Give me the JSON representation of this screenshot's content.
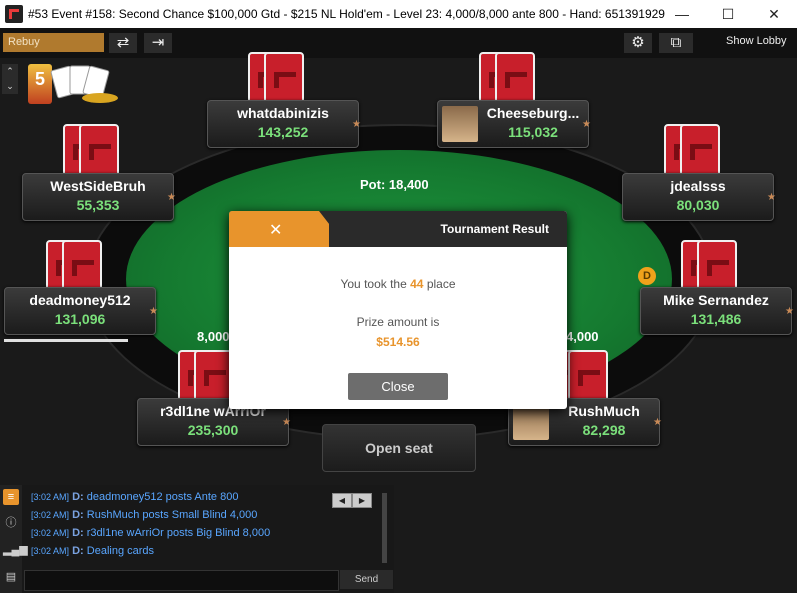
{
  "window": {
    "title": "#53 Event #158: Second Chance $100,000 Gtd - $215 NL Hold'em - Level 23: 4,000/8,000 ante 800 - Hand: 651391929",
    "minimize_glyph": "—",
    "maximize_glyph": "☐",
    "close_glyph": "✕"
  },
  "toolbar": {
    "rebuy_label": "Rebuy",
    "refresh_glyph": "⇄",
    "exit_glyph": "⇥",
    "settings_glyph": "⚙",
    "layout_glyph": "⧉",
    "show_lobby_label": "Show Lobby"
  },
  "logo": {
    "label": "5"
  },
  "table": {
    "pot_label": "Pot: 18,400",
    "dealer_label": "D",
    "open_seat_label": "Open seat"
  },
  "players": [
    {
      "name": "whatdabinizis",
      "stack": "143,252"
    },
    {
      "name": "Cheeseburg...",
      "stack": "115,032"
    },
    {
      "name": "WestSideBruh",
      "stack": "55,353"
    },
    {
      "name": "jdealsss",
      "stack": "80,030"
    },
    {
      "name": "deadmoney512",
      "stack": "131,096"
    },
    {
      "name": "Mike Sernandez",
      "stack": "131,486"
    },
    {
      "name": "r3dl1ne wArriOr",
      "stack": "235,300"
    },
    {
      "name": "RushMuch",
      "stack": "82,298"
    }
  ],
  "bets": {
    "left": "8,000",
    "right": "4,000"
  },
  "modal": {
    "close_glyph": "✕",
    "title": "Tournament Result",
    "place_prefix": "You took the",
    "place_value": "44",
    "place_suffix": "place",
    "prize_label": "Prize amount is",
    "prize_value": "$514.56",
    "close_button": "Close"
  },
  "chat": {
    "lines": [
      {
        "time": "[3:02 AM]",
        "dealer": "D:",
        "text": "deadmoney512  posts Ante 800"
      },
      {
        "time": "[3:02 AM]",
        "dealer": "D:",
        "text": "RushMuch  posts Small Blind 4,000"
      },
      {
        "time": "[3:02 AM]",
        "dealer": "D:",
        "text": "r3dl1ne wArriOr  posts Big Blind 8,000"
      },
      {
        "time": "[3:02 AM]",
        "dealer": "D:",
        "text": "Dealing cards"
      }
    ],
    "send_label": "Send",
    "prev_glyph": "◀",
    "next_glyph": "▶",
    "sidebar_icons": [
      "chat-icon",
      "info-icon",
      "stats-icon",
      "notes-icon"
    ]
  },
  "colors": {
    "accent": "#e8942c",
    "felt": "#157a30",
    "stack_green": "#7be07b",
    "card_red": "#c81f2b"
  }
}
